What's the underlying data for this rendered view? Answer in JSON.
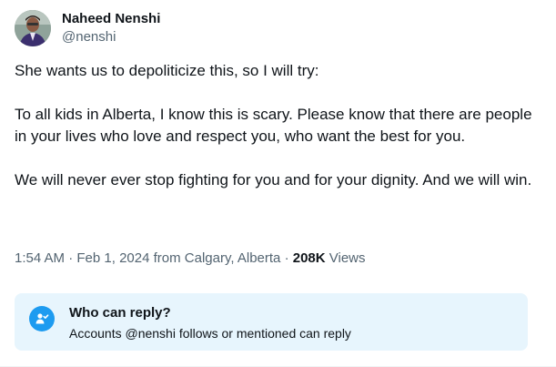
{
  "author": {
    "display_name": "Naheed Nenshi",
    "handle": "@nenshi",
    "avatar_icon": "profile-photo"
  },
  "tweet": {
    "text": "She wants us to depoliticize this, so I will try:\n\nTo all kids in Alberta, I know this is scary. Please know that there are people in your lives who love and respect you, who want the best for you.\n\nWe will never ever stop fighting for you and for your dignity. And we will win."
  },
  "meta": {
    "time": "1:54 AM",
    "separator1": " · ",
    "date": "Feb 1, 2024",
    "location": " from Calgary, Alberta",
    "separator2": " · ",
    "views_count": "208K",
    "views_label": " Views"
  },
  "reply_restriction": {
    "icon": "person-check-icon",
    "title": "Who can reply?",
    "description": "Accounts @nenshi follows or mentioned can reply"
  },
  "colors": {
    "accent": "#1d9bf0",
    "reply_box_bg": "#e7f5fd",
    "secondary_text": "#536471",
    "primary_text": "#0f1419"
  }
}
